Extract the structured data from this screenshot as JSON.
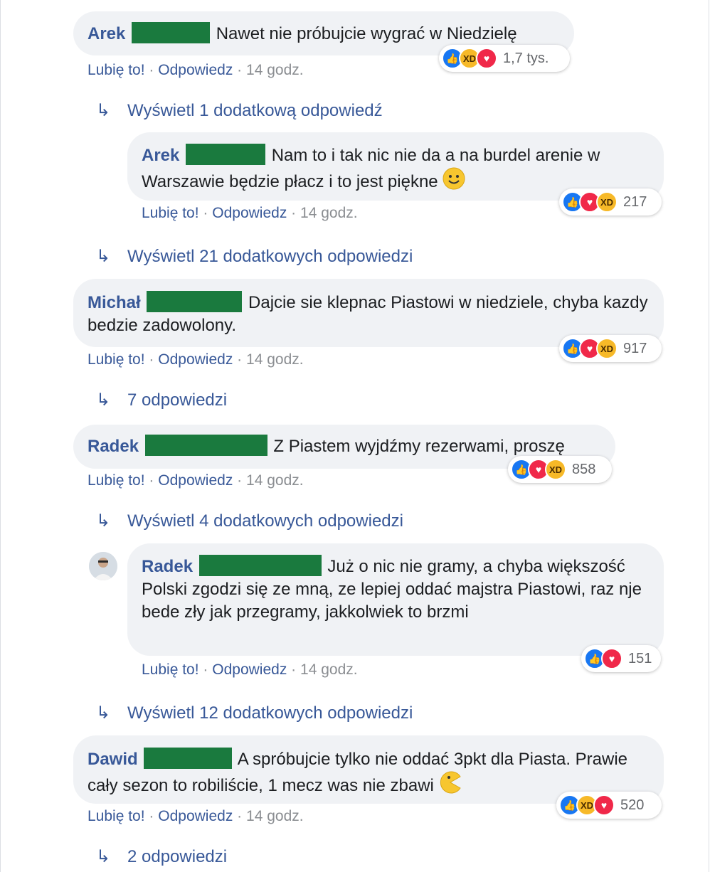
{
  "actions": {
    "like": "Lubię to!",
    "reply": "Odpowiedz",
    "dot": "·"
  },
  "comments": [
    {
      "author": "Arek",
      "text": "Nawet nie próbujcie wygrać w Niedzielę",
      "time": "14 godz.",
      "reactions": "1,7 tys."
    },
    {
      "author": "Arek",
      "text": "Nam to i tak nic nie da a na burdel arenie w Warszawie będzie płacz i to jest piękne",
      "time": "14 godz.",
      "reactions": "217"
    },
    {
      "author": "Michał",
      "text": "Dajcie sie klepnac Piastowi w niedziele, chyba kazdy bedzie zadowolony.",
      "time": "14 godz.",
      "reactions": "917"
    },
    {
      "author": "Radek",
      "text": "Z Piastem wyjdźmy rezerwami, proszę",
      "time": "14 godz.",
      "reactions": "858"
    },
    {
      "author": "Radek",
      "text": "Już o nic nie gramy, a chyba większość Polski zgodzi się ze mną, ze lepiej oddać majstra Piastowi, raz nje bede zły jak przegramy, jakkolwiek to brzmi",
      "time": "14 godz.",
      "reactions": "151"
    },
    {
      "author": "Dawid",
      "text": "A spróbujcie tylko nie oddać 3pkt dla Piasta. Prawie cały sezon to robiliście, 1 mecz was nie zbawi",
      "time": "14 godz.",
      "reactions": "520"
    }
  ],
  "more_links": [
    "Wyświetl 1 dodatkową odpowiedź",
    "Wyświetl 21 dodatkowych odpowiedzi",
    "7 odpowiedzi",
    "Wyświetl 4 dodatkowych odpowiedzi",
    "Wyświetl 12 dodatkowych odpowiedzi",
    "2 odpowiedzi"
  ],
  "icons": {
    "reply_arrow": "reply-arrow-icon",
    "like": "like-icon",
    "love": "love-icon",
    "haha": "haha-icon"
  },
  "colors": {
    "name": "#385898",
    "bubble": "#f0f2f5",
    "redaction": "#1a7a3e",
    "like": "#1877f2",
    "love": "#f02849",
    "haha": "#f7b928"
  }
}
